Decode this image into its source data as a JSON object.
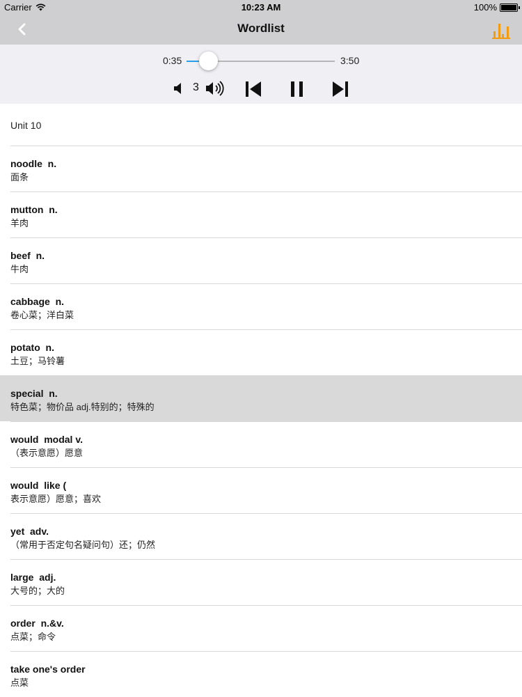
{
  "status_bar": {
    "carrier": "Carrier",
    "time": "10:23 AM",
    "battery": "100%",
    "battery_level": 1.0
  },
  "nav": {
    "title": "Wordlist",
    "back_icon": "chevron-left-icon",
    "chart_icon": "bar-chart-icon",
    "accent_color": "#f39c12"
  },
  "player": {
    "current_time": "0:35",
    "total_time": "3:50",
    "progress_fraction": 0.152,
    "volume": "3",
    "accent_color": "#2a9ee6"
  },
  "list": {
    "section_title": "Unit 10",
    "items": [
      {
        "word": "noodle  n.",
        "meaning": "面条"
      },
      {
        "word": "mutton  n.",
        "meaning": "羊肉"
      },
      {
        "word": "beef  n.",
        "meaning": "牛肉"
      },
      {
        "word": "cabbage  n.",
        "meaning": "卷心菜；洋白菜"
      },
      {
        "word": "potato  n.",
        "meaning": "土豆；马铃薯"
      },
      {
        "word": "special  n.",
        "meaning": "特色菜；物价品 adj.特别的；特殊的",
        "selected": true
      },
      {
        "word": "would  modal v.",
        "meaning": "（表示意愿）愿意"
      },
      {
        "word": "would  like (",
        "meaning": "表示意愿）愿意；喜欢"
      },
      {
        "word": "yet  adv.",
        "meaning": "（常用于否定句名疑问句）还；仍然"
      },
      {
        "word": "large  adj.",
        "meaning": "大号的；大的"
      },
      {
        "word": "order  n.&v.",
        "meaning": "点菜；命令"
      },
      {
        "word": "take one's order",
        "meaning": "点菜"
      }
    ]
  }
}
